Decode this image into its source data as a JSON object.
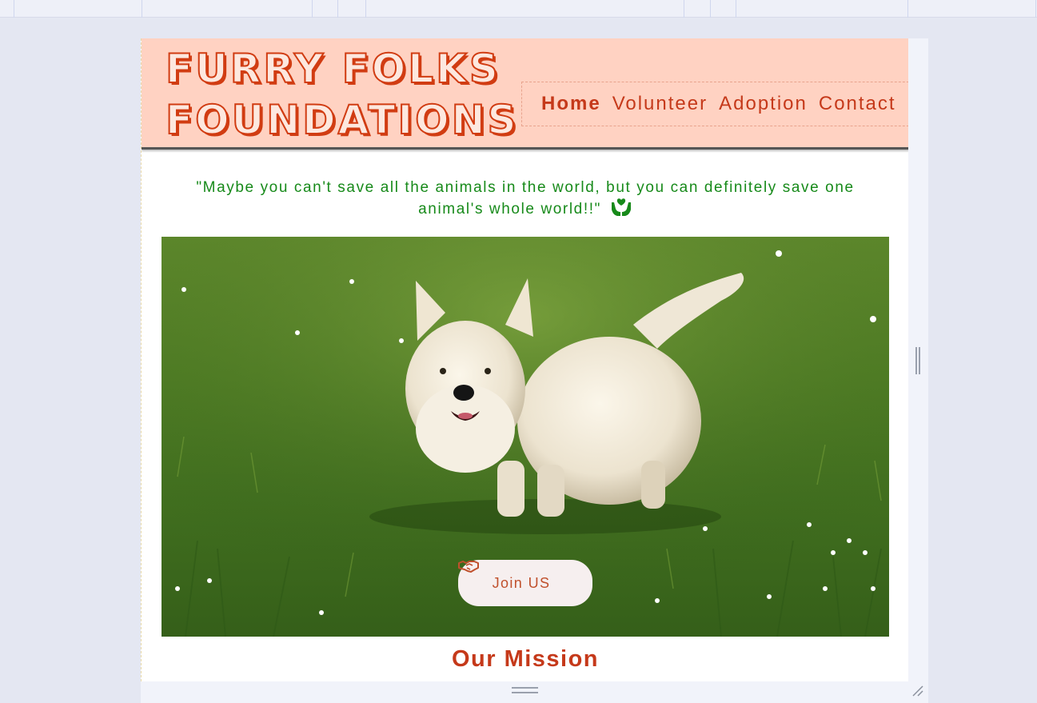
{
  "header": {
    "logo_line1": "FURRY FOLKS",
    "logo_line2": "FOUNDATIONS"
  },
  "nav": {
    "items": [
      {
        "label": "Home",
        "active": true
      },
      {
        "label": "Volunteer",
        "active": false
      },
      {
        "label": "Adoption",
        "active": false
      },
      {
        "label": "Contact",
        "active": false
      }
    ]
  },
  "quote": {
    "text": "\"Maybe you can't save all the animals in the world, but you can definitely save one animal's whole world!!\"",
    "icon": "hands-holding-heart-icon"
  },
  "hero": {
    "image": "white-terrier-on-grass",
    "button_label": "Join US",
    "button_icon": "handshake-icon"
  },
  "mission": {
    "heading": "Our Mission"
  },
  "colors": {
    "brand_red": "#c5391a",
    "header_bg": "#ffd2c2",
    "quote_green": "#178a1a",
    "button_bg": "#f6efef"
  }
}
